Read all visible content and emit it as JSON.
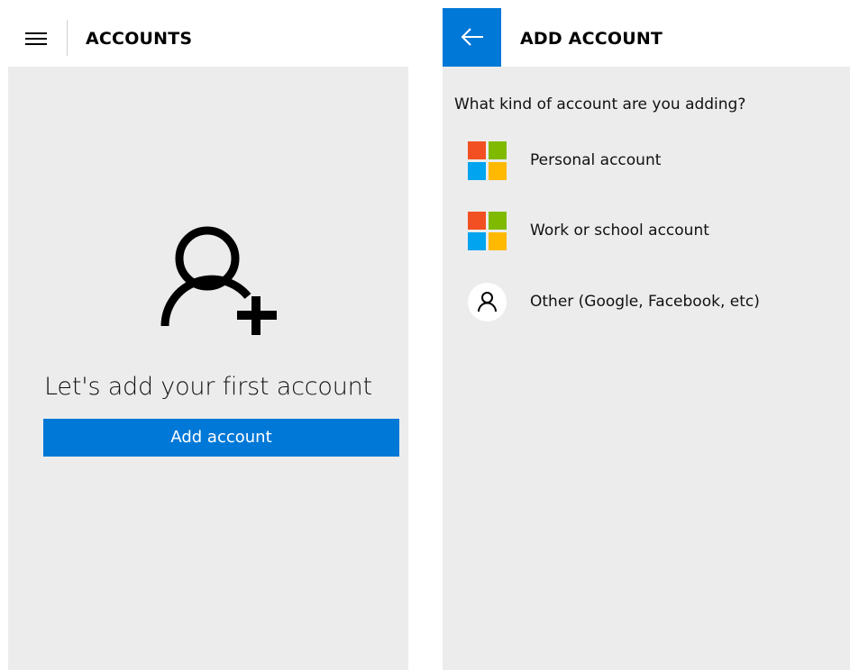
{
  "accounts_screen": {
    "title": "ACCOUNTS",
    "empty_message": "Let's add your first account",
    "add_button_label": "Add account",
    "icons": {
      "menu": "hamburger-menu-icon",
      "empty": "person-add-icon"
    }
  },
  "add_account_screen": {
    "title": "ADD ACCOUNT",
    "question": "What kind of account are you adding?",
    "back_icon": "back-arrow-icon",
    "options": [
      {
        "label": "Personal account",
        "icon": "microsoft-logo-icon"
      },
      {
        "label": "Work or school account",
        "icon": "microsoft-logo-icon"
      },
      {
        "label": "Other (Google, Facebook, etc)",
        "icon": "person-icon"
      }
    ]
  },
  "colors": {
    "accent": "#0078d7",
    "panel_background": "#ececec",
    "header_background": "#ffffff",
    "ms_red": "#f25022",
    "ms_green": "#7fba00",
    "ms_blue": "#00a4ef",
    "ms_yellow": "#ffb900"
  }
}
